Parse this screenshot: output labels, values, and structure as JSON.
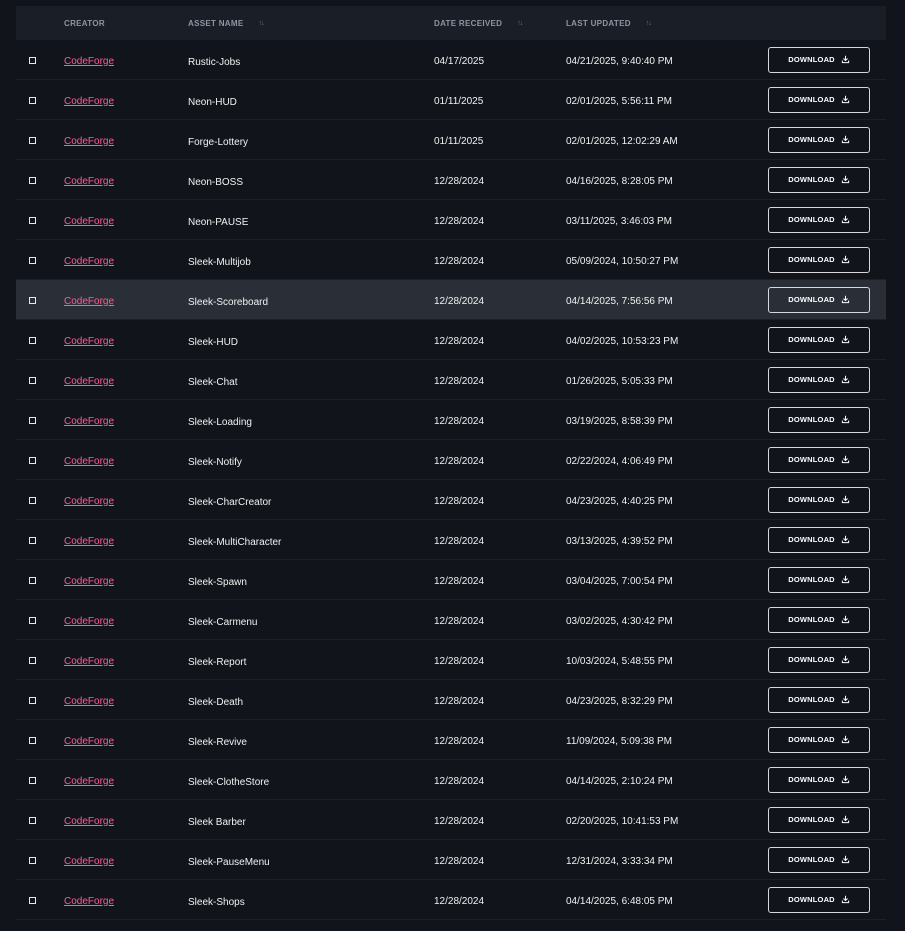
{
  "columns": {
    "creator": "CREATOR",
    "asset_name": "ASSET NAME",
    "date_received": "DATE RECEIVED",
    "last_updated": "LAST UPDATED",
    "sort_glyph": "↑↓"
  },
  "download_label": "DOWNLOAD",
  "colors": {
    "background": "#11141b",
    "header": "#1a1e27",
    "highlight_row": "#2a2e37",
    "creator_link": "#ff5c93"
  },
  "rows": [
    {
      "creator": "CodeForge",
      "name": "Rustic-Jobs",
      "received": "04/17/2025",
      "updated": "04/21/2025, 9:40:40 PM"
    },
    {
      "creator": "CodeForge",
      "name": "Neon-HUD",
      "received": "01/11/2025",
      "updated": "02/01/2025, 5:56:11 PM"
    },
    {
      "creator": "CodeForge",
      "name": "Forge-Lottery",
      "received": "01/11/2025",
      "updated": "02/01/2025, 12:02:29 AM"
    },
    {
      "creator": "CodeForge",
      "name": "Neon-BOSS",
      "received": "12/28/2024",
      "updated": "04/16/2025, 8:28:05 PM"
    },
    {
      "creator": "CodeForge",
      "name": "Neon-PAUSE",
      "received": "12/28/2024",
      "updated": "03/11/2025, 3:46:03 PM"
    },
    {
      "creator": "CodeForge",
      "name": "Sleek-Multijob",
      "received": "12/28/2024",
      "updated": "05/09/2024, 10:50:27 PM"
    },
    {
      "creator": "CodeForge",
      "name": "Sleek-Scoreboard",
      "received": "12/28/2024",
      "updated": "04/14/2025, 7:56:56 PM",
      "highlight": true
    },
    {
      "creator": "CodeForge",
      "name": "Sleek-HUD",
      "received": "12/28/2024",
      "updated": "04/02/2025, 10:53:23 PM"
    },
    {
      "creator": "CodeForge",
      "name": "Sleek-Chat",
      "received": "12/28/2024",
      "updated": "01/26/2025, 5:05:33 PM"
    },
    {
      "creator": "CodeForge",
      "name": "Sleek-Loading",
      "received": "12/28/2024",
      "updated": "03/19/2025, 8:58:39 PM"
    },
    {
      "creator": "CodeForge",
      "name": "Sleek-Notify",
      "received": "12/28/2024",
      "updated": "02/22/2024, 4:06:49 PM"
    },
    {
      "creator": "CodeForge",
      "name": "Sleek-CharCreator",
      "received": "12/28/2024",
      "updated": "04/23/2025, 4:40:25 PM"
    },
    {
      "creator": "CodeForge",
      "name": "Sleek-MultiCharacter",
      "received": "12/28/2024",
      "updated": "03/13/2025, 4:39:52 PM"
    },
    {
      "creator": "CodeForge",
      "name": "Sleek-Spawn",
      "received": "12/28/2024",
      "updated": "03/04/2025, 7:00:54 PM"
    },
    {
      "creator": "CodeForge",
      "name": "Sleek-Carmenu",
      "received": "12/28/2024",
      "updated": "03/02/2025, 4:30:42 PM"
    },
    {
      "creator": "CodeForge",
      "name": "Sleek-Report",
      "received": "12/28/2024",
      "updated": "10/03/2024, 5:48:55 PM"
    },
    {
      "creator": "CodeForge",
      "name": "Sleek-Death",
      "received": "12/28/2024",
      "updated": "04/23/2025, 8:32:29 PM"
    },
    {
      "creator": "CodeForge",
      "name": "Sleek-Revive",
      "received": "12/28/2024",
      "updated": "11/09/2024, 5:09:38 PM"
    },
    {
      "creator": "CodeForge",
      "name": "Sleek-ClotheStore",
      "received": "12/28/2024",
      "updated": "04/14/2025, 2:10:24 PM"
    },
    {
      "creator": "CodeForge",
      "name": "Sleek Barber",
      "received": "12/28/2024",
      "updated": "02/20/2025, 10:41:53 PM"
    },
    {
      "creator": "CodeForge",
      "name": "Sleek-PauseMenu",
      "received": "12/28/2024",
      "updated": "12/31/2024, 3:33:34 PM"
    },
    {
      "creator": "CodeForge",
      "name": "Sleek-Shops",
      "received": "12/28/2024",
      "updated": "04/14/2025, 6:48:05 PM"
    }
  ]
}
